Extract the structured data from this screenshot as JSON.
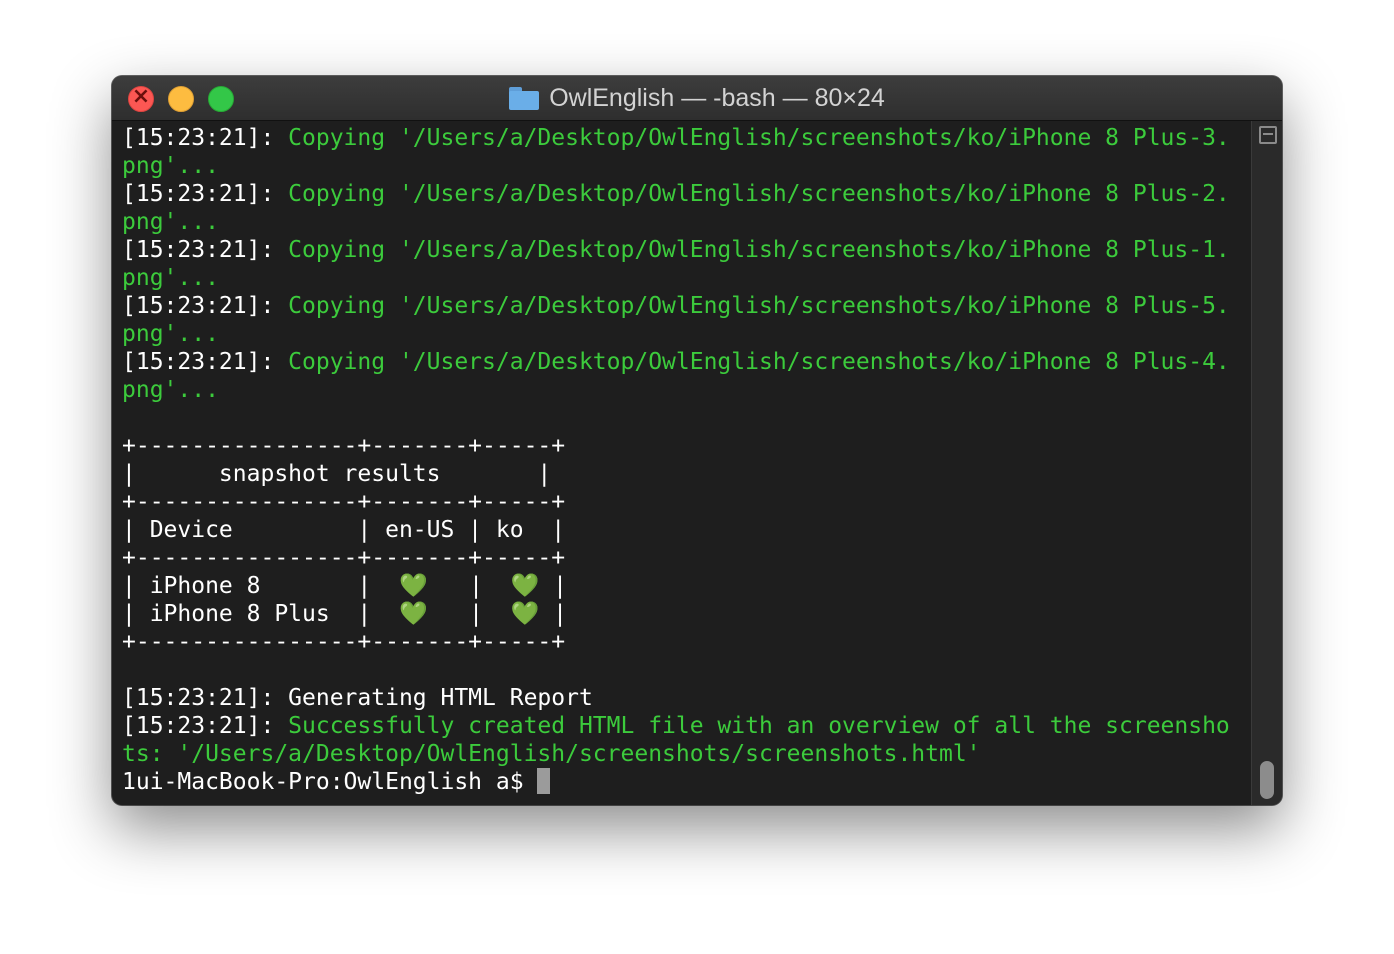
{
  "window": {
    "title": "OwlEnglish — -bash — 80×24"
  },
  "terminal": {
    "lines": [
      {
        "prefix": "[15:23:21]: ",
        "text": "Copying '/Users/a/Desktop/OwlEnglish/screenshots/ko/iPhone 8 Plus-3.",
        "color": "green"
      },
      {
        "prefix": "",
        "text": "png'...",
        "color": "green"
      },
      {
        "prefix": "[15:23:21]: ",
        "text": "Copying '/Users/a/Desktop/OwlEnglish/screenshots/ko/iPhone 8 Plus-2.",
        "color": "green"
      },
      {
        "prefix": "",
        "text": "png'...",
        "color": "green"
      },
      {
        "prefix": "[15:23:21]: ",
        "text": "Copying '/Users/a/Desktop/OwlEnglish/screenshots/ko/iPhone 8 Plus-1.",
        "color": "green"
      },
      {
        "prefix": "",
        "text": "png'...",
        "color": "green"
      },
      {
        "prefix": "[15:23:21]: ",
        "text": "Copying '/Users/a/Desktop/OwlEnglish/screenshots/ko/iPhone 8 Plus-5.",
        "color": "green"
      },
      {
        "prefix": "",
        "text": "png'...",
        "color": "green"
      },
      {
        "prefix": "[15:23:21]: ",
        "text": "Copying '/Users/a/Desktop/OwlEnglish/screenshots/ko/iPhone 8 Plus-4.",
        "color": "green"
      },
      {
        "prefix": "",
        "text": "png'...",
        "color": "green"
      },
      {
        "prefix": "",
        "text": "",
        "color": "white"
      },
      {
        "prefix": "",
        "text": "+----------------+-------+-----+",
        "color": "white"
      },
      {
        "prefix": "",
        "text": "|      snapshot results       |",
        "color": "white"
      },
      {
        "prefix": "",
        "text": "+----------------+-------+-----+",
        "color": "white"
      },
      {
        "prefix": "",
        "text": "| Device         | en-US | ko  |",
        "color": "white"
      },
      {
        "prefix": "",
        "text": "+----------------+-------+-----+",
        "color": "white"
      },
      {
        "prefix": "",
        "text": "| iPhone 8       |  💚   |  💚 |",
        "color": "white"
      },
      {
        "prefix": "",
        "text": "| iPhone 8 Plus  |  💚   |  💚 |",
        "color": "white"
      },
      {
        "prefix": "",
        "text": "+----------------+-------+-----+",
        "color": "white"
      },
      {
        "prefix": "",
        "text": "",
        "color": "white"
      },
      {
        "prefix": "[15:23:21]: ",
        "text": "Generating HTML Report",
        "color": "white"
      },
      {
        "prefix": "[15:23:21]: ",
        "text": "Successfully created HTML file with an overview of all the screensho",
        "color": "green"
      },
      {
        "prefix": "",
        "text": "ts: '/Users/a/Desktop/OwlEnglish/screenshots/screenshots.html'",
        "color": "green"
      }
    ],
    "prompt": "1ui-MacBook-Pro:OwlEnglish a$ "
  },
  "colors": {
    "background": "#1e1e1e",
    "green_text": "#3ccb3c",
    "white_text": "#ffffff"
  },
  "icons": {
    "close": "close-icon",
    "minimize": "minimize-icon",
    "maximize": "maximize-icon",
    "folder": "folder-icon",
    "heart": "green-heart-emoji",
    "split": "split-pane-icon"
  }
}
